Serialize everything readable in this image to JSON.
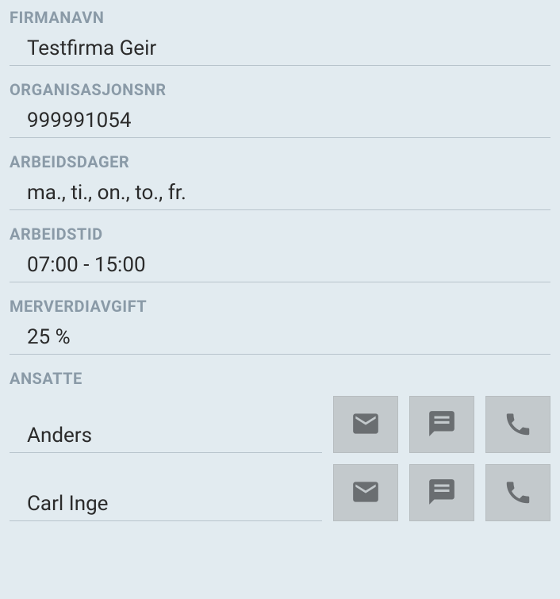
{
  "labels": {
    "firmanavn": "FIRMANAVN",
    "organisasjonsnr": "ORGANISASJONSNR",
    "arbeidsdager": "ARBEIDSDAGER",
    "arbeidstid": "ARBEIDSTID",
    "merverdiavgift": "MERVERDIAVGIFT",
    "ansatte": "ANSATTE"
  },
  "fields": {
    "firmanavn": "Testfirma Geir",
    "organisasjonsnr": "999991054",
    "arbeidsdager": "ma., ti., on., to., fr.",
    "arbeidstid": "07:00 - 15:00",
    "merverdiavgift": "25 %"
  },
  "ansatte": [
    {
      "name": "Anders"
    },
    {
      "name": "Carl Inge"
    }
  ]
}
